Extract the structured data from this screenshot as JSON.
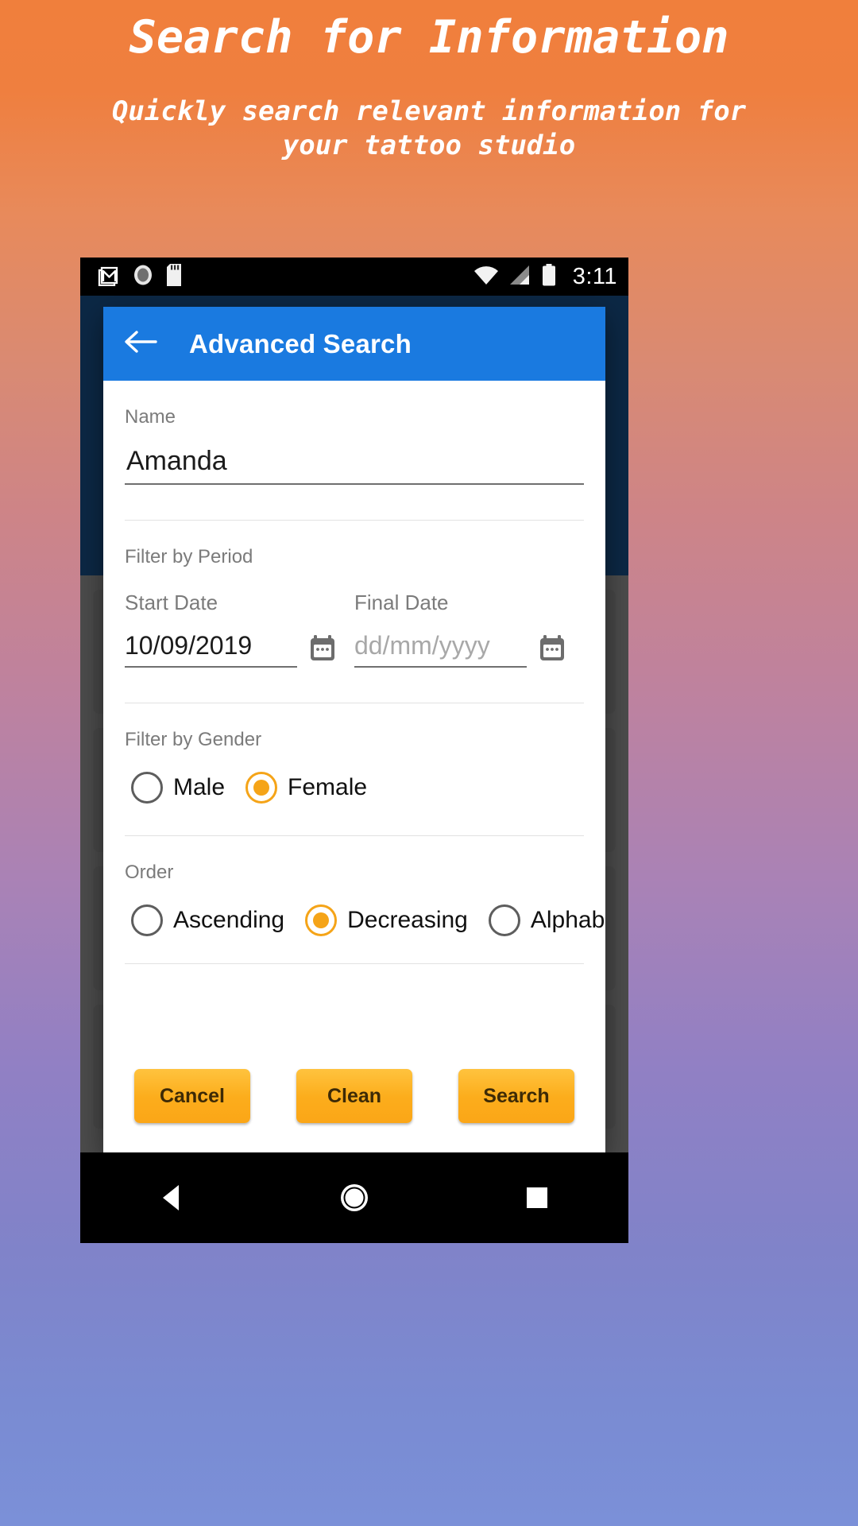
{
  "promo": {
    "title": "Search for Information",
    "subtitle": "Quickly search relevant information for your tattoo studio",
    "title_color": "#ffffff"
  },
  "statusbar": {
    "clock": "3:11",
    "icons_left": [
      "gmail-icon",
      "circle-app-icon",
      "sd-card-icon"
    ],
    "icons_right": [
      "wifi-icon",
      "cellular-signal-icon",
      "battery-icon"
    ]
  },
  "dialog": {
    "appbar": {
      "back_icon": "back-arrow-icon",
      "title": "Advanced Search",
      "color": "#1a7ae0"
    },
    "name_field": {
      "label": "Name",
      "value": "Amanda",
      "placeholder": "Name"
    },
    "period": {
      "section_label": "Filter by Period",
      "start": {
        "label": "Start Date",
        "value": "10/09/2019",
        "placeholder": "dd/mm/yyyy",
        "icon": "calendar-icon"
      },
      "final": {
        "label": "Final Date",
        "value": "",
        "placeholder": "dd/mm/yyyy",
        "icon": "calendar-icon"
      }
    },
    "gender": {
      "section_label": "Filter by Gender",
      "options": [
        {
          "label": "Male",
          "selected": false
        },
        {
          "label": "Female",
          "selected": true
        }
      ]
    },
    "order": {
      "section_label": "Order",
      "options": [
        {
          "label": "Ascending",
          "selected": false
        },
        {
          "label": "Decreasing",
          "selected": true
        },
        {
          "label": "Alphabetical",
          "selected": false
        }
      ]
    },
    "buttons": {
      "cancel": "Cancel",
      "clean": "Clean",
      "search": "Search",
      "color": "#fcad1c",
      "text_color": "#3d2a06"
    },
    "accent_color": "#f5a418"
  },
  "navbar": {
    "back": "nav-back-icon",
    "home": "nav-home-icon",
    "recents": "nav-recents-icon"
  }
}
